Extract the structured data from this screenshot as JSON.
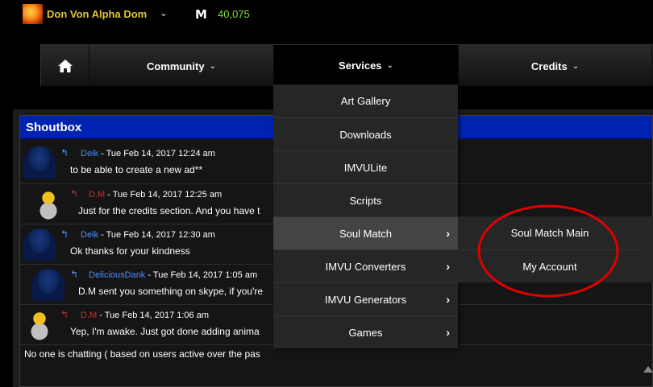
{
  "user": {
    "name": "Don Von Alpha Dom",
    "credit_symbol": "M",
    "credits": "40,075"
  },
  "nav": {
    "home_icon": "home-icon",
    "community": "Community",
    "services": "Services",
    "credits": "Credits",
    "chevron": "⌄"
  },
  "services_menu": {
    "items": [
      {
        "label": "Art Gallery"
      },
      {
        "label": "Downloads"
      },
      {
        "label": "IMVULite"
      },
      {
        "label": "Scripts"
      },
      {
        "label": "Soul Match"
      },
      {
        "label": "IMVU Converters"
      },
      {
        "label": "IMVU Generators"
      },
      {
        "label": "Games"
      }
    ],
    "submenu": [
      {
        "label": "Soul Match Main"
      },
      {
        "label": "My Account"
      }
    ]
  },
  "shoutbox": {
    "title": "Shoutbox",
    "separator": " - ",
    "shouts": [
      {
        "author": "Deik",
        "time": "Tue Feb 14, 2017 12:24 am",
        "text": "to be able to create a new ad**"
      },
      {
        "author": "D.M",
        "time": "Tue Feb 14, 2017 12:25 am",
        "text": "Just for the credits section. And you have t"
      },
      {
        "author": "Deik",
        "time": "Tue Feb 14, 2017 12:30 am",
        "text": "Ok thanks for your kindness"
      },
      {
        "author": "DeliciousDank",
        "time": "Tue Feb 14, 2017 1:05 am",
        "text": "D.M sent you something on skype, if you're"
      },
      {
        "author": "D.M",
        "time": "Tue Feb 14, 2017 1:06 am",
        "text": "Yep, I'm awake. Just got done adding anima"
      }
    ],
    "status": "No one is chatting  ( based on users active over the pas"
  },
  "colors": {
    "username": "#e0c43a",
    "credits": "#7ee02f",
    "shoutbox_header": "#0022b0",
    "link_blue": "#4a90ff",
    "link_red": "#c03030",
    "annotation": "#e00000"
  }
}
